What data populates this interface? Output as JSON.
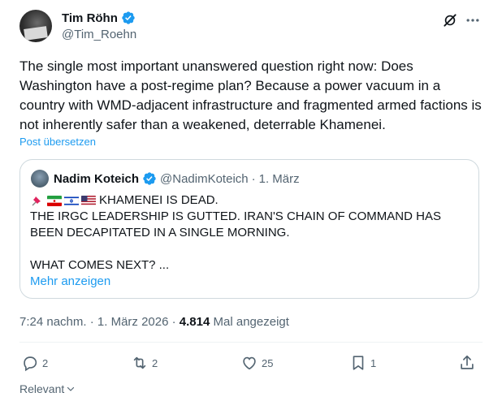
{
  "tweet": {
    "author_name": "Tim Röhn",
    "handle": "@Tim_Roehn",
    "text": "The single most important unanswered question right now: Does Washington have a post-regime plan? Because a power vacuum in a country with WMD-adjacent infrastructure and fragmented armed factions is not inherently safer than a weakened, deterrable Khamenei.",
    "translate_label": "Post übersetzen",
    "time": "7:24 nachm.",
    "date": "1. März 2026",
    "views_count": "4.814",
    "views_label": "Mal angezeigt"
  },
  "quote": {
    "author_name": "Nadim Koteich",
    "handle": "@NadimKoteich",
    "date": "1. März",
    "line1": "KHAMENEI IS DEAD.",
    "line2": "THE IRGC LEADERSHIP IS GUTTED. IRAN'S CHAIN OF COMMAND HAS BEEN DECAPITATED IN A SINGLE MORNING.",
    "line3": "WHAT COMES NEXT? ...",
    "show_more": "Mehr anzeigen"
  },
  "actions": {
    "replies": "2",
    "reposts": "2",
    "likes": "25",
    "bookmarks": "1"
  },
  "sort": {
    "label": "Relevant"
  },
  "colors": {
    "accent": "#1d9bf0",
    "muted": "#536471",
    "text": "#0f1419",
    "border": "#cfd9de"
  },
  "icons": [
    "verified-badge-icon",
    "grok-icon",
    "more-icon",
    "reply-icon",
    "repost-icon",
    "like-icon",
    "bookmark-icon",
    "share-icon",
    "chevron-down-icon",
    "pin-icon"
  ]
}
